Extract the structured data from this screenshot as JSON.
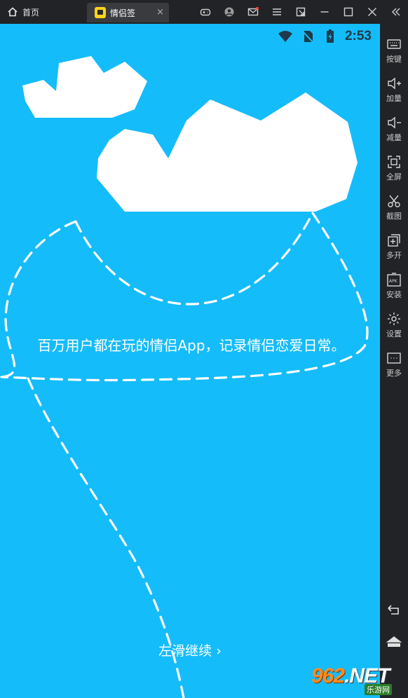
{
  "titlebar": {
    "home_label": "首页",
    "app_tab_label": "情侣签",
    "close_glyph": "×",
    "icons": [
      "gamepad-icon",
      "user-icon",
      "mail-icon",
      "menu-icon",
      "shrink-icon",
      "minimize-icon",
      "maximize-icon",
      "close-icon",
      "collapse-icon"
    ]
  },
  "status": {
    "time": "2:53",
    "icons": [
      "wifi-icon",
      "no-sim-icon",
      "battery-icon"
    ]
  },
  "onboarding": {
    "headline": "百万用户都在玩的情侣App，记录情侣恋爱日常。",
    "swipe_hint": "左滑继续 ›",
    "background_color": "#15bcfa"
  },
  "sidebar": {
    "items": [
      {
        "label": "按键",
        "icon": "keyboard-icon"
      },
      {
        "label": "加量",
        "icon": "volume-up-icon"
      },
      {
        "label": "减量",
        "icon": "volume-down-icon"
      },
      {
        "label": "全屏",
        "icon": "fullscreen-icon"
      },
      {
        "label": "截图",
        "icon": "scissors-icon"
      },
      {
        "label": "多开",
        "icon": "multi-open-icon"
      },
      {
        "label": "安装",
        "icon": "apk-icon"
      },
      {
        "label": "设置",
        "icon": "gear-icon"
      },
      {
        "label": "更多",
        "icon": "more-icon"
      }
    ],
    "nav": [
      "back-icon",
      "home-icon"
    ]
  },
  "watermark": {
    "number": "962",
    "suffix": ".NET",
    "sub": "乐游网"
  }
}
